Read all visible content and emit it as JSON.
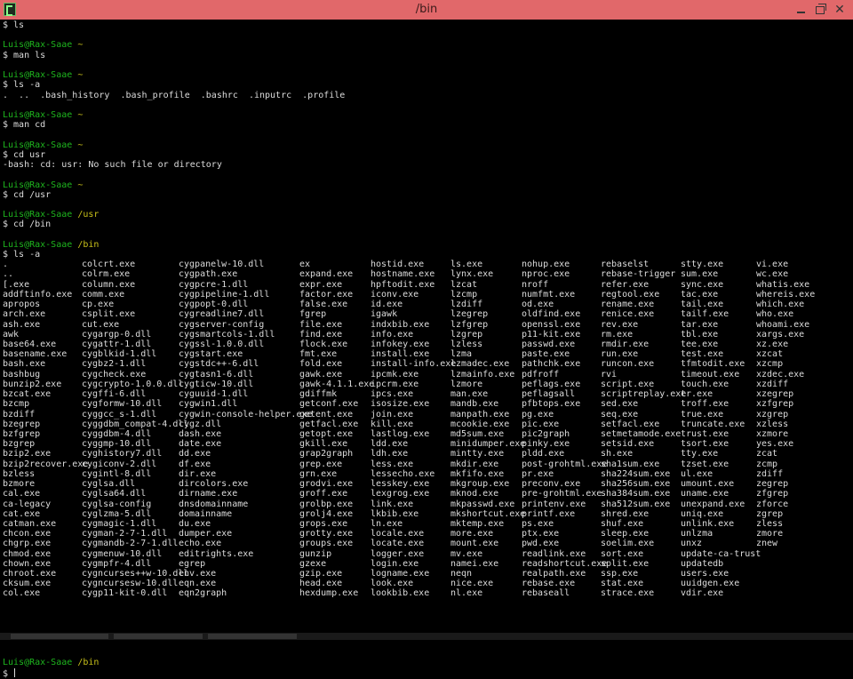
{
  "window": {
    "title": "/bin"
  },
  "prompt": {
    "user": "Luis@Rax-Saae"
  },
  "history": [
    {
      "type": "cmd",
      "text": "$ ls"
    },
    {
      "type": "blank"
    },
    {
      "type": "prompt",
      "path": "~"
    },
    {
      "type": "cmd",
      "text": "$ man ls"
    },
    {
      "type": "blank"
    },
    {
      "type": "prompt",
      "path": "~"
    },
    {
      "type": "cmd",
      "text": "$ ls -a"
    },
    {
      "type": "out",
      "text": ".  ..  .bash_history  .bash_profile  .bashrc  .inputrc  .profile"
    },
    {
      "type": "blank"
    },
    {
      "type": "prompt",
      "path": "~"
    },
    {
      "type": "cmd",
      "text": "$ man cd"
    },
    {
      "type": "blank"
    },
    {
      "type": "prompt",
      "path": "~"
    },
    {
      "type": "cmd",
      "text": "$ cd usr"
    },
    {
      "type": "out",
      "text": "-bash: cd: usr: No such file or directory"
    },
    {
      "type": "blank"
    },
    {
      "type": "prompt",
      "path": "~"
    },
    {
      "type": "cmd",
      "text": "$ cd /usr"
    },
    {
      "type": "blank"
    },
    {
      "type": "prompt",
      "path": "/usr"
    },
    {
      "type": "cmd",
      "text": "$ cd /bin"
    },
    {
      "type": "blank"
    },
    {
      "type": "prompt",
      "path": "/bin"
    },
    {
      "type": "cmd",
      "text": "$ ls -a"
    }
  ],
  "ls_columns": [
    [
      ".",
      "..",
      "[.exe",
      "addftinfo.exe",
      "apropos",
      "arch.exe",
      "ash.exe",
      "awk",
      "base64.exe",
      "basename.exe",
      "bash.exe",
      "bashbug",
      "bunzip2.exe",
      "bzcat.exe",
      "bzcmp",
      "bzdiff",
      "bzegrep",
      "bzfgrep",
      "bzgrep",
      "bzip2.exe",
      "bzip2recover.exe",
      "bzless",
      "bzmore",
      "cal.exe",
      "ca-legacy",
      "cat.exe",
      "catman.exe",
      "chcon.exe",
      "chgrp.exe",
      "chmod.exe",
      "chown.exe",
      "chroot.exe",
      "cksum.exe",
      "col.exe"
    ],
    [
      "colcrt.exe",
      "colrm.exe",
      "column.exe",
      "comm.exe",
      "cp.exe",
      "csplit.exe",
      "cut.exe",
      "cygargp-0.dll",
      "cygattr-1.dll",
      "cygblkid-1.dll",
      "cygbz2-1.dll",
      "cygcheck.exe",
      "cygcrypto-1.0.0.dll",
      "cygffi-6.dll",
      "cygformw-10.dll",
      "cyggcc_s-1.dll",
      "cyggdbm_compat-4.dll",
      "cyggdbm-4.dll",
      "cyggmp-10.dll",
      "cyghistory7.dll",
      "cygiconv-2.dll",
      "cygintl-8.dll",
      "cyglsa.dll",
      "cyglsa64.dll",
      "cyglsa-config",
      "cyglzma-5.dll",
      "cygmagic-1.dll",
      "cygman-2-7-1.dll",
      "cygmandb-2-7-1.dll",
      "cygmenuw-10.dll",
      "cygmpfr-4.dll",
      "cygncurses++w-10.dll",
      "cygncursesw-10.dll",
      "cygp11-kit-0.dll"
    ],
    [
      "cygpanelw-10.dll",
      "cygpath.exe",
      "cygpcre-1.dll",
      "cygpipeline-1.dll",
      "cygpopt-0.dll",
      "cygreadline7.dll",
      "cygserver-config",
      "cygsmartcols-1.dll",
      "cygssl-1.0.0.dll",
      "cygstart.exe",
      "cygstdc++-6.dll",
      "cygtasn1-6.dll",
      "cygticw-10.dll",
      "cyguuid-1.dll",
      "cygwin1.dll",
      "cygwin-console-helper.exe",
      "cygz.dll",
      "dash.exe",
      "date.exe",
      "dd.exe",
      "df.exe",
      "dir.exe",
      "dircolors.exe",
      "dirname.exe",
      "dnsdomainname",
      "domainname",
      "du.exe",
      "dumper.exe",
      "echo.exe",
      "editrights.exe",
      "egrep",
      "env.exe",
      "eqn.exe",
      "eqn2graph"
    ],
    [
      "ex",
      "expand.exe",
      "expr.exe",
      "factor.exe",
      "false.exe",
      "fgrep",
      "file.exe",
      "find.exe",
      "flock.exe",
      "fmt.exe",
      "fold.exe",
      "gawk.exe",
      "gawk-4.1.1.exe",
      "gdiffmk",
      "getconf.exe",
      "getent.exe",
      "getfacl.exe",
      "getopt.exe",
      "gkill.exe",
      "grap2graph",
      "grep.exe",
      "grn.exe",
      "grodvi.exe",
      "groff.exe",
      "grolbp.exe",
      "grolj4.exe",
      "grops.exe",
      "grotty.exe",
      "groups.exe",
      "gunzip",
      "gzexe",
      "gzip.exe",
      "head.exe",
      "hexdump.exe"
    ],
    [
      "hostid.exe",
      "hostname.exe",
      "hpftodit.exe",
      "iconv.exe",
      "id.exe",
      "igawk",
      "indxbib.exe",
      "info.exe",
      "infokey.exe",
      "install.exe",
      "install-info.exe",
      "ipcmk.exe",
      "ipcrm.exe",
      "ipcs.exe",
      "isosize.exe",
      "join.exe",
      "kill.exe",
      "lastlog.exe",
      "ldd.exe",
      "ldh.exe",
      "less.exe",
      "lessecho.exe",
      "lesskey.exe",
      "lexgrog.exe",
      "link.exe",
      "lkbib.exe",
      "ln.exe",
      "locale.exe",
      "locate.exe",
      "logger.exe",
      "login.exe",
      "logname.exe",
      "look.exe",
      "lookbib.exe"
    ],
    [
      "ls.exe",
      "lynx.exe",
      "lzcat",
      "lzcmp",
      "lzdiff",
      "lzegrep",
      "lzfgrep",
      "lzgrep",
      "lzless",
      "lzma",
      "lzmadec.exe",
      "lzmainfo.exe",
      "lzmore",
      "man.exe",
      "mandb.exe",
      "manpath.exe",
      "mcookie.exe",
      "md5sum.exe",
      "minidumper.exe",
      "mintty.exe",
      "mkdir.exe",
      "mkfifo.exe",
      "mkgroup.exe",
      "mknod.exe",
      "mkpasswd.exe",
      "mkshortcut.exe",
      "mktemp.exe",
      "more.exe",
      "mount.exe",
      "mv.exe",
      "namei.exe",
      "neqn",
      "nice.exe",
      "nl.exe"
    ],
    [
      "nohup.exe",
      "nproc.exe",
      "nroff",
      "numfmt.exe",
      "od.exe",
      "oldfind.exe",
      "openssl.exe",
      "p11-kit.exe",
      "passwd.exe",
      "paste.exe",
      "pathchk.exe",
      "pdfroff",
      "peflags.exe",
      "peflagsall",
      "pfbtops.exe",
      "pg.exe",
      "pic.exe",
      "pic2graph",
      "pinky.exe",
      "pldd.exe",
      "post-grohtml.exe",
      "pr.exe",
      "preconv.exe",
      "pre-grohtml.exe",
      "printenv.exe",
      "printf.exe",
      "ps.exe",
      "ptx.exe",
      "pwd.exe",
      "readlink.exe",
      "readshortcut.exe",
      "realpath.exe",
      "rebase.exe",
      "rebaseall"
    ],
    [
      "rebaselst",
      "rebase-trigger",
      "refer.exe",
      "regtool.exe",
      "rename.exe",
      "renice.exe",
      "rev.exe",
      "rm.exe",
      "rmdir.exe",
      "run.exe",
      "runcon.exe",
      "rvi",
      "script.exe",
      "scriptreplay.exe",
      "sed.exe",
      "seq.exe",
      "setfacl.exe",
      "setmetamode.exe",
      "setsid.exe",
      "sh.exe",
      "sha1sum.exe",
      "sha224sum.exe",
      "sha256sum.exe",
      "sha384sum.exe",
      "sha512sum.exe",
      "shred.exe",
      "shuf.exe",
      "sleep.exe",
      "soelim.exe",
      "sort.exe",
      "split.exe",
      "ssp.exe",
      "stat.exe",
      "strace.exe"
    ],
    [
      "stty.exe",
      "sum.exe",
      "sync.exe",
      "tac.exe",
      "tail.exe",
      "tailf.exe",
      "tar.exe",
      "tbl.exe",
      "tee.exe",
      "test.exe",
      "tfmtodit.exe",
      "timeout.exe",
      "touch.exe",
      "tr.exe",
      "troff.exe",
      "true.exe",
      "truncate.exe",
      "trust.exe",
      "tsort.exe",
      "tty.exe",
      "tzset.exe",
      "ul.exe",
      "umount.exe",
      "uname.exe",
      "unexpand.exe",
      "uniq.exe",
      "unlink.exe",
      "unlzma",
      "unxz",
      "update-ca-trust",
      "updatedb",
      "users.exe",
      "uuidgen.exe",
      "vdir.exe"
    ],
    [
      "vi.exe",
      "wc.exe",
      "whatis.exe",
      "whereis.exe",
      "which.exe",
      "who.exe",
      "whoami.exe",
      "xargs.exe",
      "xz.exe",
      "xzcat",
      "xzcmp",
      "xzdec.exe",
      "xzdiff",
      "xzegrep",
      "xzfgrep",
      "xzgrep",
      "xzless",
      "xzmore",
      "yes.exe",
      "zcat",
      "zcmp",
      "zdiff",
      "zegrep",
      "zfgrep",
      "zforce",
      "zgrep",
      "zless",
      "zmore",
      "znew"
    ]
  ],
  "final_prompt": {
    "path": "/bin",
    "input": "$ "
  },
  "colors": {
    "titlebar": "#e1686a",
    "prompt_user": "#1eb51e",
    "prompt_path": "#c8c01a",
    "text": "#dcdcdc",
    "background": "#000000"
  }
}
